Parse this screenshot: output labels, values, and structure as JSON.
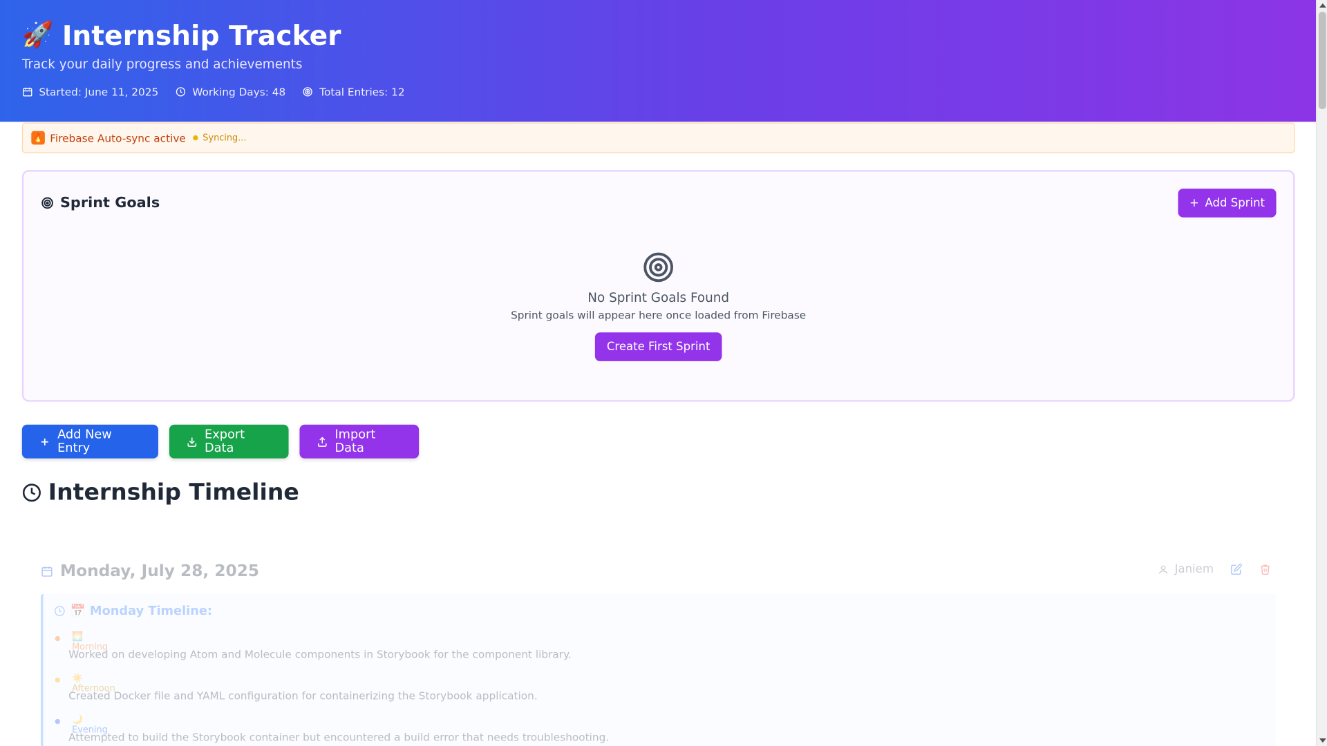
{
  "header": {
    "emoji": "🚀",
    "title": "Internship Tracker",
    "subtitle": "Track your daily progress and achievements",
    "stats": {
      "started": "Started: June 11, 2025",
      "working_days": "Working Days: 48",
      "total_entries": "Total Entries: 12"
    }
  },
  "sync": {
    "icon": "fire-icon",
    "label": "Firebase Auto-sync active",
    "status": "Syncing..."
  },
  "sprint": {
    "title": "Sprint Goals",
    "add_button": "Add Sprint",
    "empty_title": "No Sprint Goals Found",
    "empty_text": "Sprint goals will appear here once loaded from Firebase",
    "create_button": "Create First Sprint"
  },
  "actions": {
    "add_entry": "Add New Entry",
    "export": "Export Data",
    "import": "Import Data"
  },
  "timeline": {
    "title": "Internship Timeline",
    "entry": {
      "date": "Monday, July 28, 2025",
      "author": "Janiem",
      "panel_title": "📅 Monday Timeline:",
      "slots": [
        {
          "tag": "🌅 Morning",
          "desc": "Worked on developing Atom and Molecule components in Storybook for the component library."
        },
        {
          "tag": "☀️ Afternoon",
          "desc": "Created Docker file and YAML configuration for containerizing the Storybook application."
        },
        {
          "tag": "🌙 Evening",
          "desc": "Attempted to build the Storybook container but encountered a build error that needs troubleshooting."
        }
      ]
    }
  },
  "colors": {
    "header_gradient_start": "#2f64ea",
    "header_gradient_end": "#8c35e6",
    "purple": "#9333ea",
    "blue": "#2563eb",
    "green": "#16a34a"
  }
}
